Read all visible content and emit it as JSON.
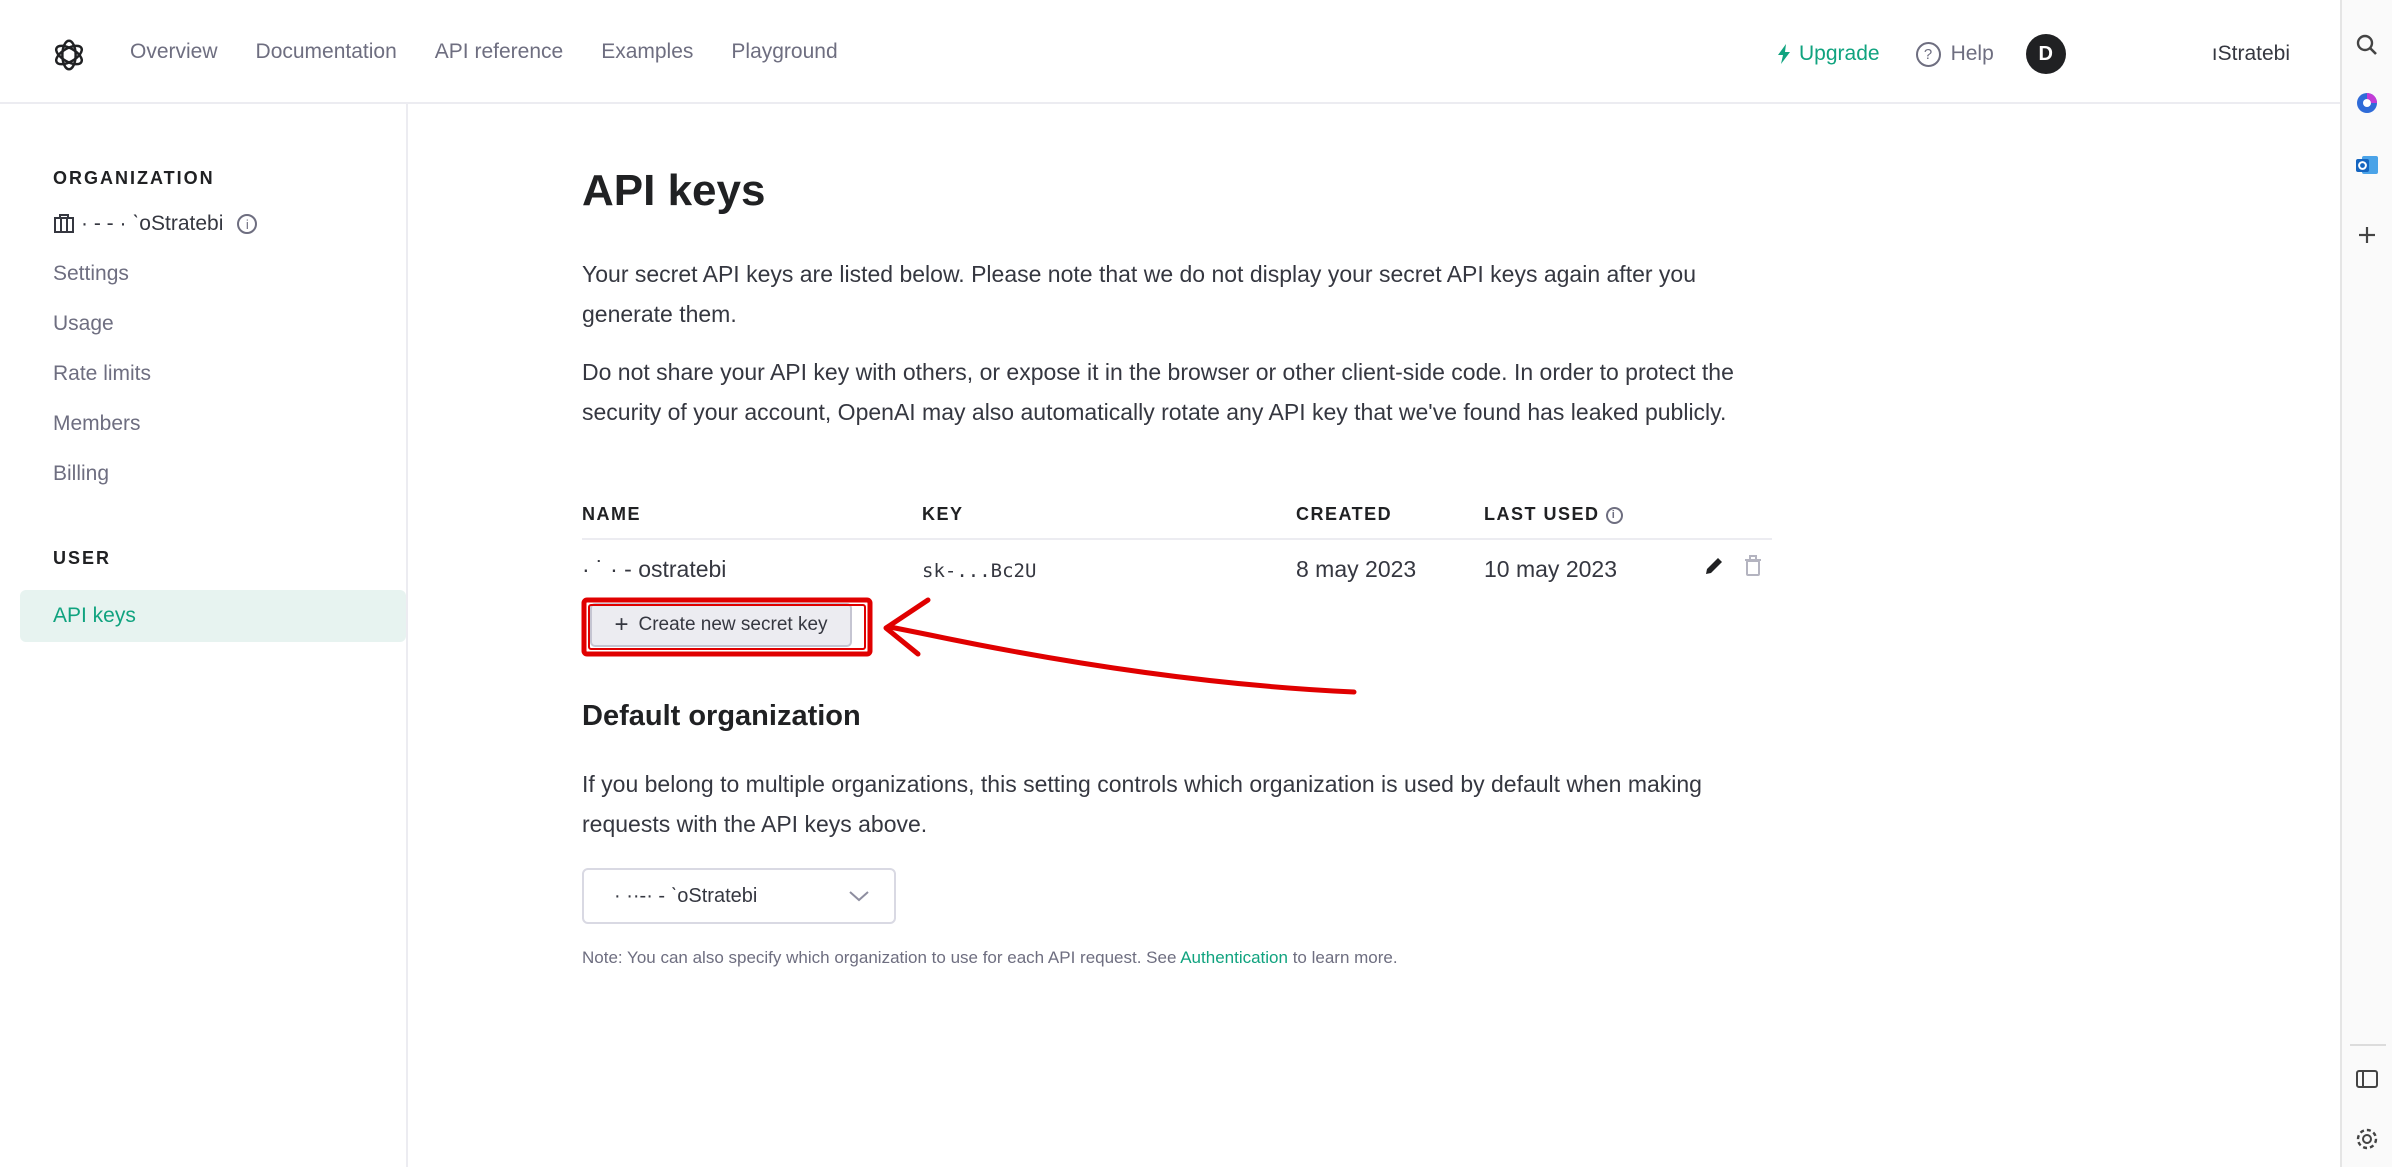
{
  "nav": {
    "links": [
      "Overview",
      "Documentation",
      "API reference",
      "Examples",
      "Playground"
    ],
    "upgrade": "Upgrade",
    "help": "Help",
    "avatar_initial": "D",
    "username": "ıStratebi"
  },
  "sidebar": {
    "org_heading": "ORGANIZATION",
    "org_name": "· - ‐ · ˋoStratebi",
    "items": [
      "Settings",
      "Usage",
      "Rate limits",
      "Members",
      "Billing"
    ],
    "user_heading": "USER",
    "active_item": "API keys"
  },
  "main": {
    "title": "API keys",
    "intro1": "Your secret API keys are listed below. Please note that we do not display your secret API keys again after you generate them.",
    "intro2": "Do not share your API key with others, or expose it in the browser or other client-side code. In order to protect the security of your account, OpenAI may also automatically rotate any API key that we've found has leaked publicly.",
    "table": {
      "headers": [
        "NAME",
        "KEY",
        "CREATED",
        "LAST USED"
      ],
      "rows": [
        {
          "name": "· ˙ · ‐ ostratebi",
          "key": "sk-...Bc2U",
          "created": "8 may 2023",
          "last_used": "10 may 2023"
        }
      ]
    },
    "create_button": "Create new secret key",
    "default_org_title": "Default organization",
    "default_org_text": "If you belong to multiple organizations, this setting controls which organization is used by default when making requests with the API keys above.",
    "org_select_value": "· ··‐· ‐ ˋoStratebi",
    "note_prefix": "Note: You can also specify which organization to use for each API request. See ",
    "note_link": "Authentication",
    "note_suffix": " to learn more."
  },
  "colors": {
    "accent": "#10a37f",
    "annotation": "#e00000",
    "active_bg": "#e7f3f0"
  }
}
